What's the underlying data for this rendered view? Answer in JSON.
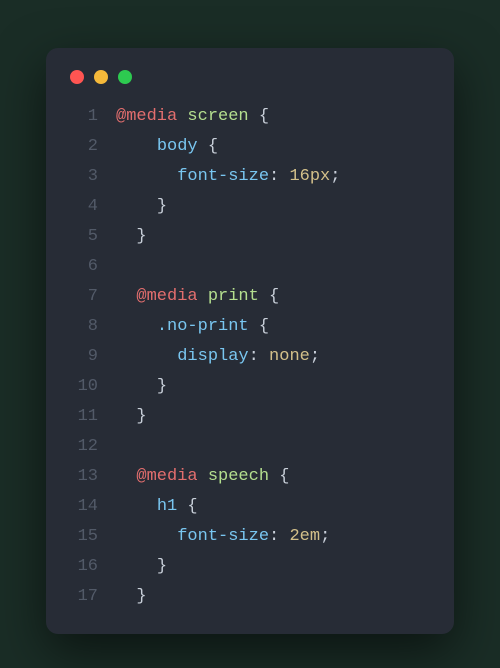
{
  "traffic_lights": {
    "red": "#ff5552",
    "yellow": "#f5b93a",
    "green": "#2dca50"
  },
  "code": {
    "lines": [
      {
        "n": "1",
        "indent": "",
        "tokens": [
          {
            "t": "@media",
            "c": "at"
          },
          {
            "t": " ",
            "c": "sp"
          },
          {
            "t": "screen",
            "c": "kw"
          },
          {
            "t": " {",
            "c": "brace"
          }
        ]
      },
      {
        "n": "2",
        "indent": "    ",
        "tokens": [
          {
            "t": "body",
            "c": "sel"
          },
          {
            "t": " {",
            "c": "brace"
          }
        ]
      },
      {
        "n": "3",
        "indent": "      ",
        "tokens": [
          {
            "t": "font-size",
            "c": "prop"
          },
          {
            "t": ": ",
            "c": "brace"
          },
          {
            "t": "16px",
            "c": "val"
          },
          {
            "t": ";",
            "c": "brace"
          }
        ]
      },
      {
        "n": "4",
        "indent": "    ",
        "tokens": [
          {
            "t": "}",
            "c": "brace"
          }
        ]
      },
      {
        "n": "5",
        "indent": "  ",
        "tokens": [
          {
            "t": "}",
            "c": "brace"
          }
        ]
      },
      {
        "n": "6",
        "indent": "",
        "tokens": []
      },
      {
        "n": "7",
        "indent": "  ",
        "tokens": [
          {
            "t": "@media",
            "c": "at"
          },
          {
            "t": " ",
            "c": "sp"
          },
          {
            "t": "print",
            "c": "kw"
          },
          {
            "t": " {",
            "c": "brace"
          }
        ]
      },
      {
        "n": "8",
        "indent": "    ",
        "tokens": [
          {
            "t": ".no-print",
            "c": "sel"
          },
          {
            "t": " {",
            "c": "brace"
          }
        ]
      },
      {
        "n": "9",
        "indent": "      ",
        "tokens": [
          {
            "t": "display",
            "c": "prop"
          },
          {
            "t": ": ",
            "c": "brace"
          },
          {
            "t": "none",
            "c": "val"
          },
          {
            "t": ";",
            "c": "brace"
          }
        ]
      },
      {
        "n": "10",
        "indent": "    ",
        "tokens": [
          {
            "t": "}",
            "c": "brace"
          }
        ]
      },
      {
        "n": "11",
        "indent": "  ",
        "tokens": [
          {
            "t": "}",
            "c": "brace"
          }
        ]
      },
      {
        "n": "12",
        "indent": "",
        "tokens": []
      },
      {
        "n": "13",
        "indent": "  ",
        "tokens": [
          {
            "t": "@media",
            "c": "at"
          },
          {
            "t": " ",
            "c": "sp"
          },
          {
            "t": "speech",
            "c": "kw"
          },
          {
            "t": " {",
            "c": "brace"
          }
        ]
      },
      {
        "n": "14",
        "indent": "    ",
        "tokens": [
          {
            "t": "h1",
            "c": "sel"
          },
          {
            "t": " {",
            "c": "brace"
          }
        ]
      },
      {
        "n": "15",
        "indent": "      ",
        "tokens": [
          {
            "t": "font-size",
            "c": "prop"
          },
          {
            "t": ": ",
            "c": "brace"
          },
          {
            "t": "2em",
            "c": "val"
          },
          {
            "t": ";",
            "c": "brace"
          }
        ]
      },
      {
        "n": "16",
        "indent": "    ",
        "tokens": [
          {
            "t": "}",
            "c": "brace"
          }
        ]
      },
      {
        "n": "17",
        "indent": "  ",
        "tokens": [
          {
            "t": "}",
            "c": "brace"
          }
        ]
      }
    ]
  }
}
